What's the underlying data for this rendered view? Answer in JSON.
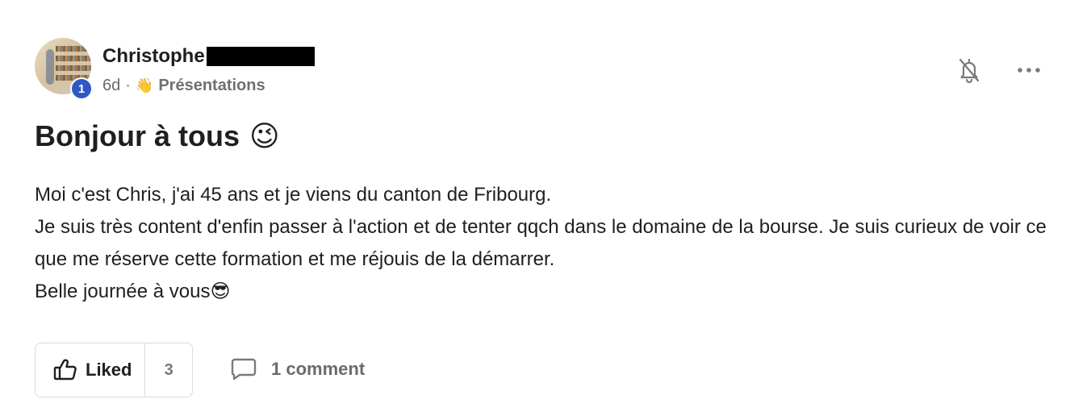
{
  "post": {
    "author": {
      "name": "Christophe",
      "level": "1"
    },
    "meta": {
      "time": "6d",
      "separator": "·",
      "category_emoji": "👋",
      "category": "Présentations"
    },
    "title": "Bonjour à tous",
    "title_emoji": "😉",
    "body": {
      "lines": [
        "Moi c'est Chris, j'ai 45 ans et je viens du canton de Fribourg.",
        "Je suis très content d'enfin passer à l'action et de tenter qqch dans le domaine de la bourse. Je suis curieux de voir ce que me réserve cette formation et me réjouis de la démarrer.",
        "Belle journée à vous😎"
      ]
    },
    "actions": {
      "like_label": "Liked",
      "like_count": "3",
      "comment_label": "1 comment"
    }
  },
  "icons": {
    "notifications_off": "bell-off-icon",
    "more": "more-horizontal-icon",
    "like": "thumbs-up-icon",
    "comment": "comment-icon"
  },
  "colors": {
    "level_badge": "#2f58c4",
    "text_primary": "#1f1f1f",
    "text_secondary": "#6b6b6b",
    "border": "#dcdcdc"
  }
}
